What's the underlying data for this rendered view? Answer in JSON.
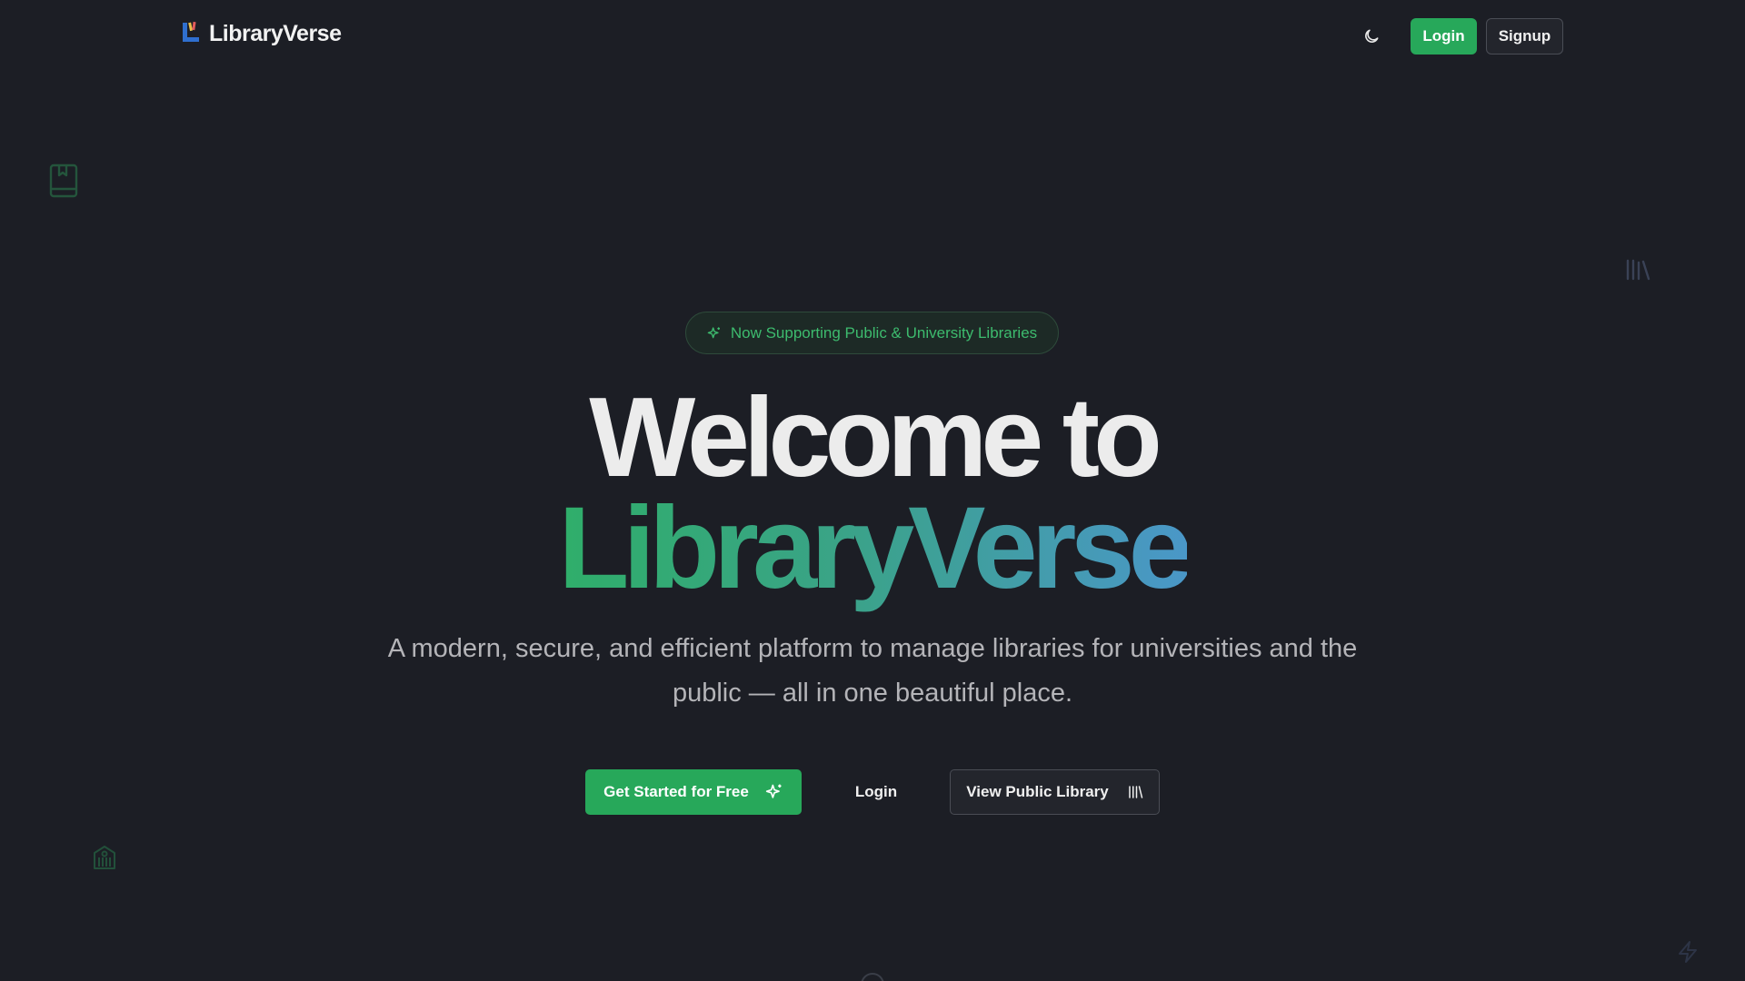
{
  "nav": {
    "brand_name": "LibraryVerse",
    "login_label": "Login",
    "signup_label": "Signup"
  },
  "hero": {
    "badge_text": "Now Supporting Public & University Libraries",
    "title_line1": "Welcome to",
    "title_line2": "LibraryVerse",
    "subtitle": "A modern, secure, and efficient platform to manage libraries for universities and the public — all in one beautiful place.",
    "cta_primary_label": "Get Started for Free",
    "cta_login_label": "Login",
    "cta_public_label": "View Public Library"
  },
  "colors": {
    "background": "#1c1e25",
    "accent_green": "#27a85a",
    "gradient_start": "#2fae6a",
    "gradient_end": "#4a97c8"
  },
  "icons": {
    "logo": "library-logo-icon",
    "theme_toggle": "moon-icon",
    "badge": "sparkles-icon",
    "cta_primary": "sparkles-icon",
    "cta_public": "library-books-icon"
  }
}
